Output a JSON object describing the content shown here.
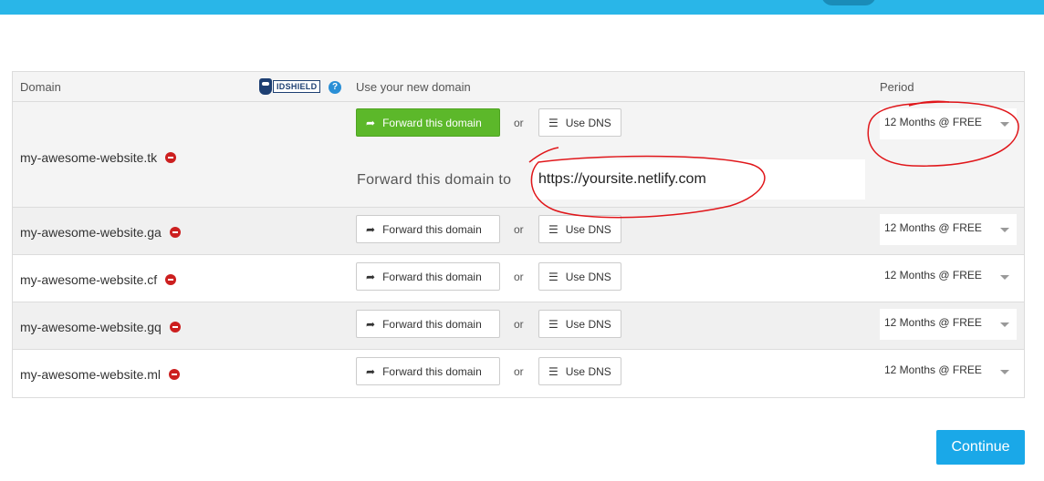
{
  "header": {
    "col_domain": "Domain",
    "idshield_label": "IDSHIELD",
    "help_glyph": "?",
    "col_use": "Use your new domain",
    "col_period": "Period"
  },
  "rows": [
    {
      "domain": "my-awesome-website.tk",
      "forward_label": "Forward this domain",
      "or": "or",
      "dns_label": "Use DNS",
      "period": "12 Months @ FREE",
      "forward_active": true
    },
    {
      "domain": "my-awesome-website.ga",
      "forward_label": "Forward this domain",
      "or": "or",
      "dns_label": "Use DNS",
      "period": "12 Months @ FREE"
    },
    {
      "domain": "my-awesome-website.cf",
      "forward_label": "Forward this domain",
      "or": "or",
      "dns_label": "Use DNS",
      "period": "12 Months @ FREE"
    },
    {
      "domain": "my-awesome-website.gq",
      "forward_label": "Forward this domain",
      "or": "or",
      "dns_label": "Use DNS",
      "period": "12 Months @ FREE"
    },
    {
      "domain": "my-awesome-website.ml",
      "forward_label": "Forward this domain",
      "or": "or",
      "dns_label": "Use DNS",
      "period": "12 Months @ FREE"
    }
  ],
  "forward": {
    "label": "Forward this domain to",
    "value": "https://yoursite.netlify.com"
  },
  "continue_label": "Continue",
  "colors": {
    "topbar": "#29b6e8",
    "forward_active": "#5cb82a",
    "remove": "#cc1f1f",
    "continue": "#1aa8e8",
    "annotation": "#e0161a"
  },
  "icons": {
    "forward": "share-arrow-icon",
    "dns": "list-icon",
    "remove": "remove-icon",
    "help": "help-icon"
  }
}
